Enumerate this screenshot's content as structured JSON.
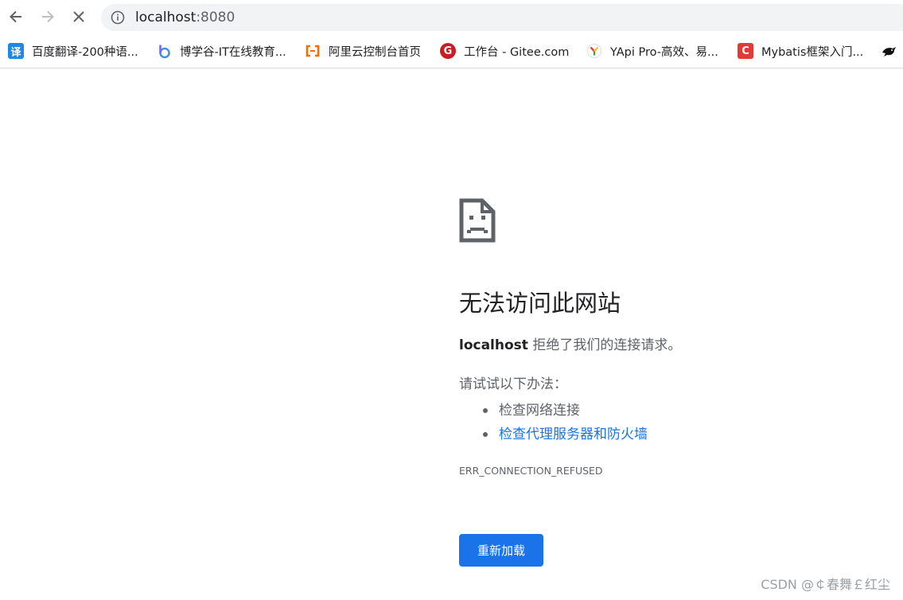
{
  "toolbar": {
    "url_host": "localhost",
    "url_port": ":8080",
    "icons": {
      "back": "arrow-left-icon",
      "forward": "arrow-right-icon",
      "stop": "close-icon",
      "info": "info-icon"
    }
  },
  "bookmarks": [
    {
      "label": "百度翻译-200种语...",
      "icon": "baidu-translate-icon",
      "glyph": "译",
      "color": "#1e88e5"
    },
    {
      "label": "博学谷-IT在线教育...",
      "icon": "boxuegu-icon",
      "glyph": "b",
      "color": "#4a90e2"
    },
    {
      "label": "阿里云控制台首页",
      "icon": "aliyun-icon",
      "glyph": "-",
      "color": "#ff6a00"
    },
    {
      "label": "工作台 - Gitee.com",
      "icon": "gitee-icon",
      "glyph": "G",
      "color": "#c71d23"
    },
    {
      "label": "YApi Pro-高效、易...",
      "icon": "yapi-icon",
      "glyph": "Y",
      "color": "#7cb342"
    },
    {
      "label": "Mybatis框架入门...",
      "icon": "csdn-icon",
      "glyph": "C",
      "color": "#e53935"
    },
    {
      "label": "",
      "icon": "bird-icon",
      "glyph": "",
      "color": "#111111"
    }
  ],
  "error": {
    "title": "无法访问此网站",
    "host": "localhost",
    "message": " 拒绝了我们的连接请求。",
    "suggestions_heading": "请试试以下办法：",
    "suggestions": [
      "检查网络连接",
      "检查代理服务器和防火墙"
    ],
    "code": "ERR_CONNECTION_REFUSED",
    "reload_label": "重新加载",
    "icon": "sad-document-icon"
  },
  "watermark": "CSDN @￠春舞￡红尘",
  "colors": {
    "accent": "#1a73e8",
    "text_primary": "#202124",
    "text_secondary": "#5f6368",
    "omnibox_bg": "#f1f3f4"
  }
}
